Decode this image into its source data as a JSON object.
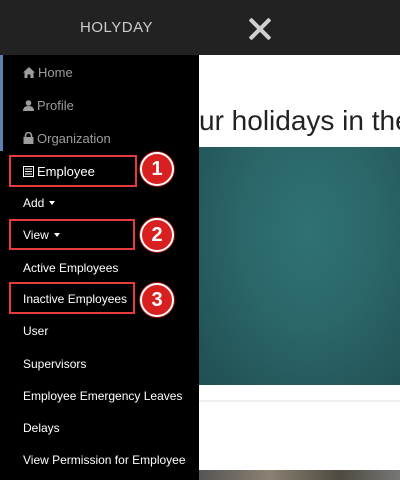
{
  "header": {
    "brand": "HOLYDAY",
    "close_icon": "close-icon"
  },
  "sidebar": {
    "items": [
      {
        "label": "Home",
        "icon": "home-icon"
      },
      {
        "label": "Profile",
        "icon": "user-icon"
      },
      {
        "label": "Organization",
        "icon": "lock-icon"
      },
      {
        "label": "Employee",
        "icon": "list-icon"
      },
      {
        "label": "Add"
      },
      {
        "label": "View"
      },
      {
        "label": "Active Employees"
      },
      {
        "label": "Inactive Employees"
      },
      {
        "label": "User"
      },
      {
        "label": "Supervisors"
      },
      {
        "label": "Employee Emergency Leaves"
      },
      {
        "label": "Delays"
      },
      {
        "label": "View Permission for Employee"
      }
    ]
  },
  "annotations": [
    "1",
    "2",
    "3"
  ],
  "annotation_color": "#e53b3b",
  "main": {
    "hero_text": "ur holidays in the"
  }
}
